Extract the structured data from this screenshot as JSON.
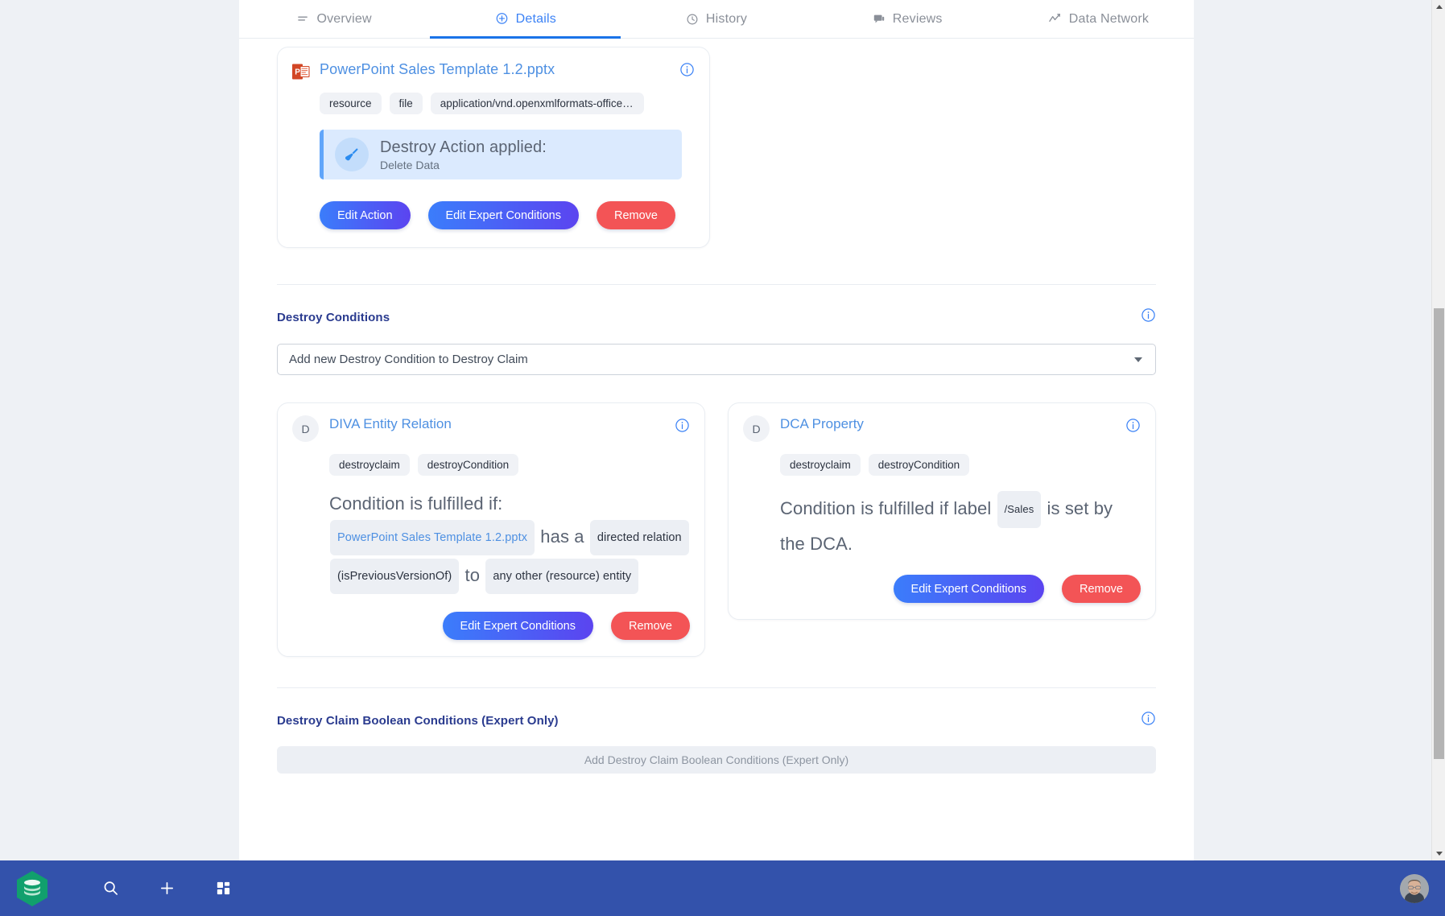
{
  "tabs": [
    {
      "id": "overview",
      "label": "Overview",
      "icon": "list-icon",
      "active": false
    },
    {
      "id": "details",
      "label": "Details",
      "icon": "plus-circle-icon",
      "active": true
    },
    {
      "id": "history",
      "label": "History",
      "icon": "clock-icon",
      "active": false
    },
    {
      "id": "reviews",
      "label": "Reviews",
      "icon": "comment-icon",
      "active": false
    },
    {
      "id": "data-network",
      "label": "Data Network",
      "icon": "trend-line-icon",
      "active": false
    }
  ],
  "resource_card": {
    "file_icon": "powerpoint-icon",
    "title": "PowerPoint Sales Template 1.2.pptx",
    "info_icon": "info-icon",
    "pills": [
      "resource",
      "file",
      "application/vnd.openxmlformats-officedoc…"
    ],
    "banner": {
      "icon": "broom-icon",
      "heading": "Destroy Action applied:",
      "subtext": "Delete Data"
    },
    "buttons": [
      {
        "label": "Edit Action",
        "style": "primary"
      },
      {
        "label": "Edit Expert Conditions",
        "style": "primary"
      },
      {
        "label": "Remove",
        "style": "danger"
      }
    ]
  },
  "destroy_conditions": {
    "section_title": "Destroy Conditions",
    "info_icon": "info-icon",
    "select": {
      "value": "Add new Destroy Condition to Destroy Claim",
      "caret_icon": "chevron-down-icon"
    },
    "cards": [
      {
        "avatar_letter": "D",
        "title": "DIVA Entity Relation",
        "info_icon": "info-icon",
        "pills": [
          "destroyclaim",
          "destroyCondition"
        ],
        "body_lead": "Condition is fulfilled if:",
        "body_tokens": [
          {
            "type": "token-link",
            "text": "PowerPoint Sales Template 1.2.pptx"
          },
          {
            "type": "text",
            "text": "has a"
          },
          {
            "type": "token",
            "text": "directed relation"
          },
          {
            "type": "token",
            "text": "(isPreviousVersionOf)"
          },
          {
            "type": "text",
            "text": "to"
          },
          {
            "type": "token",
            "text": "any other (resource) entity"
          }
        ],
        "buttons": [
          {
            "label": "Edit Expert Conditions",
            "style": "primary"
          },
          {
            "label": "Remove",
            "style": "danger"
          }
        ]
      },
      {
        "avatar_letter": "D",
        "title": "DCA Property",
        "info_icon": "info-icon",
        "pills": [
          "destroyclaim",
          "destroyCondition"
        ],
        "body_lead": "",
        "body_tokens": [
          {
            "type": "text",
            "text": "Condition is fulfilled if label"
          },
          {
            "type": "token-small",
            "text": "/Sales"
          },
          {
            "type": "text",
            "text": "is set by the DCA."
          }
        ],
        "buttons": [
          {
            "label": "Edit Expert Conditions",
            "style": "primary"
          },
          {
            "label": "Remove",
            "style": "danger"
          }
        ]
      }
    ]
  },
  "boolean_section": {
    "section_title": "Destroy Claim Boolean Conditions (Expert Only)",
    "info_icon": "info-icon",
    "placeholder": "Add Destroy Claim Boolean Conditions (Expert Only)"
  },
  "bottom_bar": {
    "logo_icon": "layers-hexagon-logo",
    "icons": [
      {
        "name": "search-icon"
      },
      {
        "name": "plus-icon"
      },
      {
        "name": "grid-icon"
      }
    ],
    "avatar": "user-avatar"
  },
  "colors": {
    "accent_blue": "#4e90e2",
    "tab_active": "#1a73e8",
    "section_title": "#2a3b8f",
    "btn_gradient_from": "#3b7dfb",
    "btn_gradient_to": "#5b44f0",
    "btn_danger": "#f35456",
    "banner_bg": "#dbeafe",
    "banner_border": "#60a5fa",
    "pill_bg": "#f0f2f6",
    "page_bg": "#eef1f5",
    "bottom_bar": "#3352ab",
    "logo_green": "#12a06a"
  }
}
